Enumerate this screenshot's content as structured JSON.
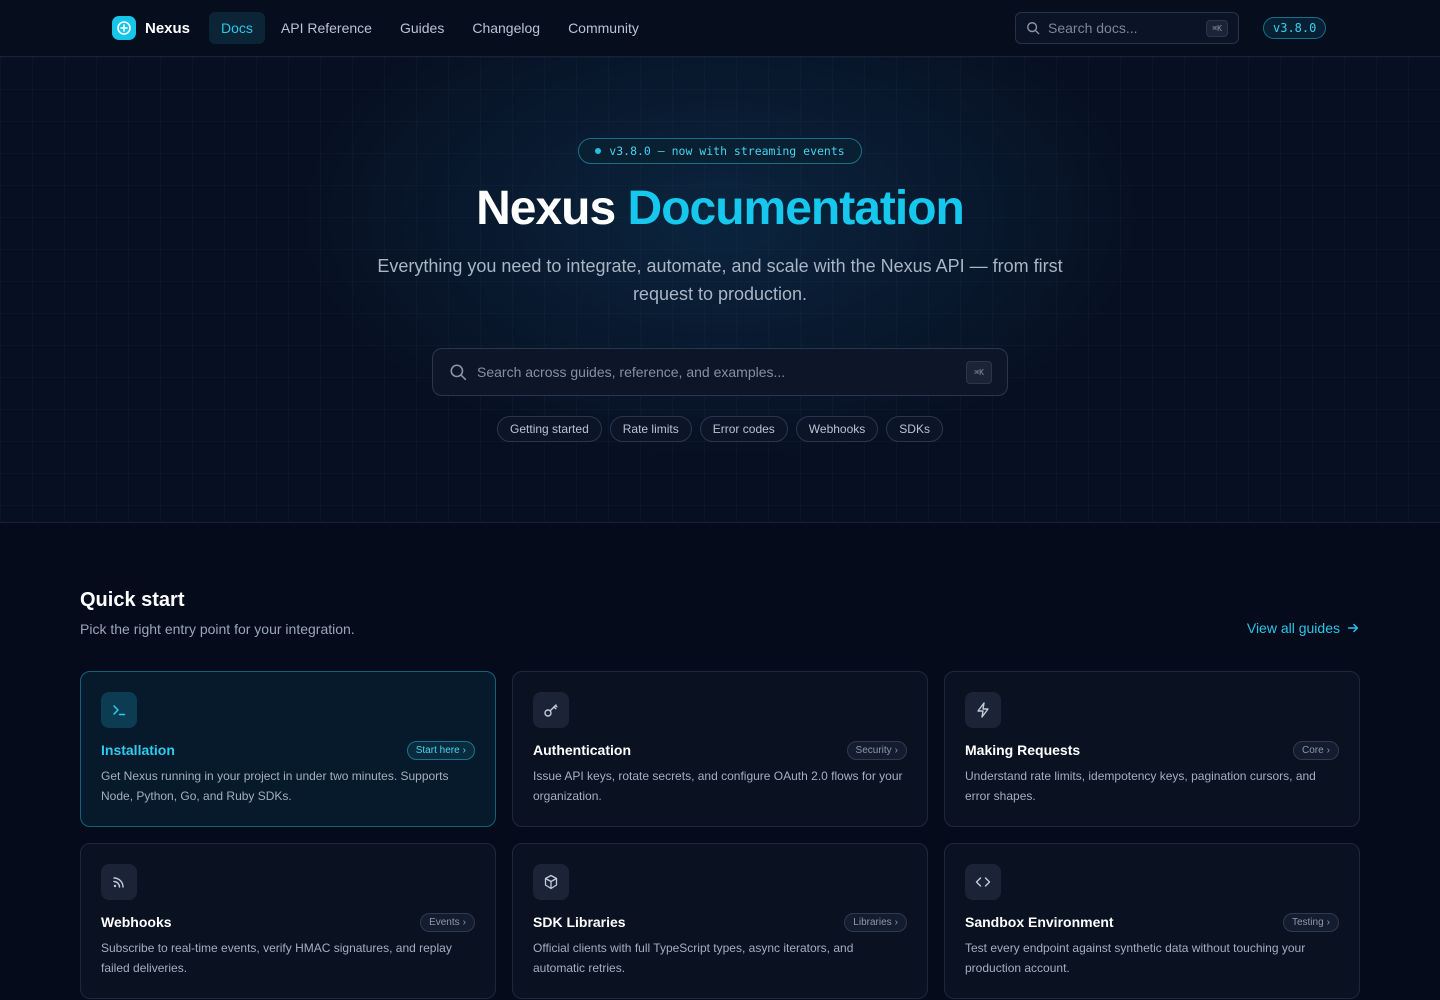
{
  "nav": {
    "brand": "Nexus",
    "links": [
      "Docs",
      "API Reference",
      "Guides",
      "Changelog",
      "Community"
    ],
    "active_link": "Docs",
    "search_placeholder": "Search docs...",
    "search_shortcut": "⌘K",
    "version": "v3.8.0"
  },
  "hero": {
    "release_pill": "v3.8.0 — now with streaming events",
    "title_main": "Nexus",
    "title_accent": "Documentation",
    "subtitle": "Everything you need to integrate, automate, and scale with the Nexus API — from first request to production.",
    "search_placeholder": "Search across guides, reference, and examples...",
    "search_shortcut": "⌘K",
    "chips": [
      "Getting started",
      "Rate limits",
      "Error codes",
      "Webhooks",
      "SDKs"
    ]
  },
  "quick_start": {
    "title": "Quick start",
    "subtitle": "Pick the right entry point for your integration.",
    "view_all": "View all guides",
    "cards": [
      {
        "title": "Installation",
        "tag": "Start here",
        "icon": "terminal-icon",
        "desc": "Get Nexus running in your project in under two minutes. Supports Node, Python, Go, and Ruby SDKs."
      },
      {
        "title": "Authentication",
        "tag": "Security",
        "icon": "key-icon",
        "desc": "Issue API keys, rotate secrets, and configure OAuth 2.0 flows for your organization."
      },
      {
        "title": "Making Requests",
        "tag": "Core",
        "icon": "bolt-icon",
        "desc": "Understand rate limits, idempotency keys, pagination cursors, and error shapes."
      },
      {
        "title": "Webhooks",
        "tag": "Events",
        "icon": "rss-icon",
        "desc": "Subscribe to real-time events, verify HMAC signatures, and replay failed deliveries."
      },
      {
        "title": "SDK Libraries",
        "tag": "Libraries",
        "icon": "package-icon",
        "desc": "Official clients with full TypeScript types, async iterators, and automatic retries."
      },
      {
        "title": "Sandbox Environment",
        "tag": "Testing",
        "icon": "code-icon",
        "desc": "Test every endpoint against synthetic data without touching your production account."
      }
    ]
  },
  "colors": {
    "accent": "#16c8ee",
    "background": "#050b1a"
  }
}
